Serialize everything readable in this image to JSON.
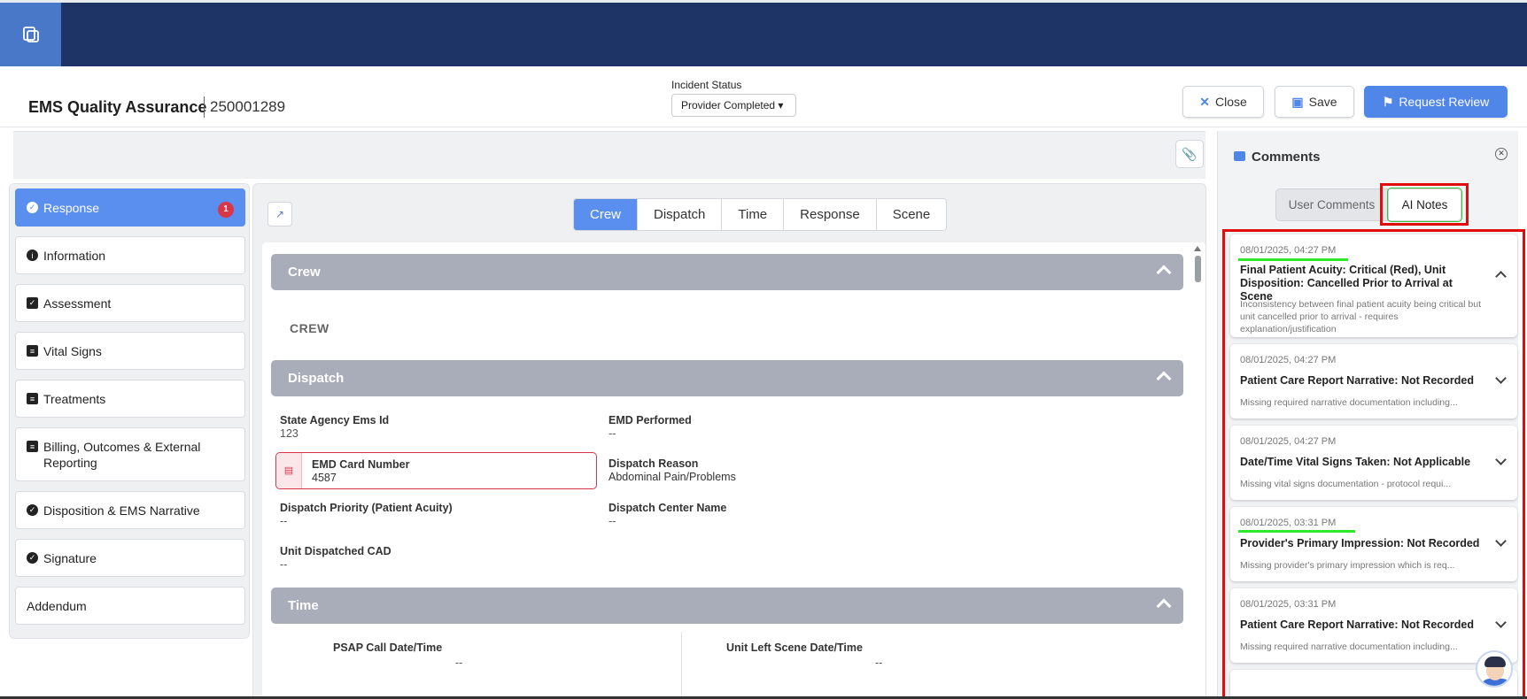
{
  "app": {
    "title": "EMS Quality Assurance",
    "incident_id": "250001289",
    "logo_icon": "document-stack-icon"
  },
  "incident_status": {
    "label": "Incident Status",
    "value": "Provider Completed ▾"
  },
  "actions": {
    "close_label": "Close",
    "save_label": "Save",
    "review_label": "Request Review",
    "close_icon": "✕",
    "save_icon": "▣",
    "review_icon": "⚑"
  },
  "sidebar": {
    "items": [
      {
        "label": "Response",
        "icon": "check-circle-icon",
        "glyph": "✓",
        "badge": "1",
        "active": true
      },
      {
        "label": "Information",
        "icon": "info-icon",
        "glyph": "i"
      },
      {
        "label": "Assessment",
        "icon": "clipboard-check-icon",
        "glyph": "✓"
      },
      {
        "label": "Vital Signs",
        "icon": "file-icon",
        "glyph": "≡"
      },
      {
        "label": "Treatments",
        "icon": "file-icon",
        "glyph": "≡"
      },
      {
        "label": "Billing, Outcomes & External Reporting",
        "icon": "file-icon",
        "glyph": "≡"
      },
      {
        "label": "Disposition & EMS Narrative",
        "icon": "check-circle-icon",
        "glyph": "✓"
      },
      {
        "label": "Signature",
        "icon": "check-circle-icon",
        "glyph": "✓"
      },
      {
        "label": "Addendum"
      }
    ]
  },
  "tabs": [
    "Crew",
    "Dispatch",
    "Time",
    "Response",
    "Scene"
  ],
  "active_tab": "Crew",
  "sections": {
    "crew": {
      "title": "Crew",
      "sub_label": "CREW"
    },
    "dispatch": {
      "title": "Dispatch",
      "fields": {
        "state_agency_label": "State Agency Ems Id",
        "state_agency_value": "123",
        "emd_performed_label": "EMD Performed",
        "emd_performed_value": "--",
        "emd_card_label": "EMD Card Number",
        "emd_card_value": "4587",
        "dispatch_reason_label": "Dispatch Reason",
        "dispatch_reason_value": "Abdominal Pain/Problems",
        "dispatch_priority_label": "Dispatch Priority (Patient Acuity)",
        "dispatch_priority_value": "--",
        "dispatch_center_label": "Dispatch Center Name",
        "dispatch_center_value": "--",
        "unit_cad_label": "Unit Dispatched CAD",
        "unit_cad_value": "--"
      }
    },
    "time": {
      "title": "Time",
      "fields": {
        "psap_label": "PSAP Call Date/Time",
        "psap_value": "--",
        "left_scene_label": "Unit Left Scene Date/Time",
        "left_scene_value": "--"
      }
    }
  },
  "comments": {
    "title": "Comments",
    "tab_user": "User Comments",
    "tab_ai": "AI Notes",
    "active_tab": "AI Notes",
    "notes": [
      {
        "date": "08/01/2025, 04:27 PM",
        "title": "Final Patient Acuity: Critical (Red), Unit Disposition: Cancelled Prior to Arrival at Scene",
        "desc": "Inconsistency between final patient acuity being critical but unit cancelled prior to arrival - requires explanation/justification",
        "expanded": true,
        "highlight": true
      },
      {
        "date": "08/01/2025, 04:27 PM",
        "title": "Patient Care Report Narrative: Not Recorded",
        "desc": "Missing required narrative documentation including...",
        "expanded": false
      },
      {
        "date": "08/01/2025, 04:27 PM",
        "title": "Date/Time Vital Signs Taken: Not Applicable",
        "desc": "Missing vital signs documentation - protocol requi...",
        "expanded": false
      },
      {
        "date": "08/01/2025, 03:31 PM",
        "title": "Provider's Primary Impression: Not Recorded",
        "desc": "Missing provider's primary impression which is req...",
        "expanded": false,
        "highlight": true
      },
      {
        "date": "08/01/2025, 03:31 PM",
        "title": "Patient Care Report Narrative: Not Recorded",
        "desc": "Missing required narrative documentation including...",
        "expanded": false
      }
    ]
  },
  "colors": {
    "topbar": "#1f3466",
    "accent": "#4f86e8",
    "alert": "#d9364a",
    "annotation_red": "#e10d0d",
    "annotation_green": "#2ee82b"
  }
}
